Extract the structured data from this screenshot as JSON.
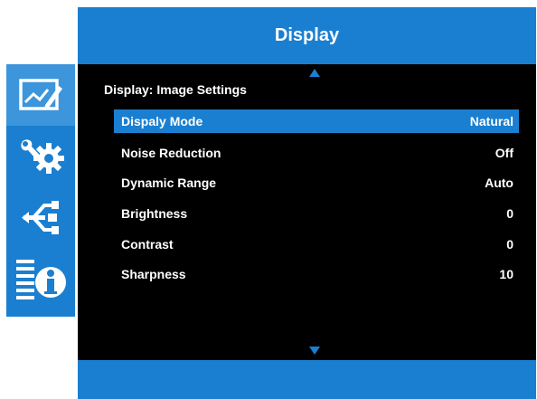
{
  "header": {
    "title": "Display"
  },
  "sidebar": {
    "items": [
      {
        "icon": "image-settings-icon",
        "active": true
      },
      {
        "icon": "tools-gear-icon",
        "active": false
      },
      {
        "icon": "usb-connection-icon",
        "active": false
      },
      {
        "icon": "information-icon",
        "active": false
      }
    ]
  },
  "panel": {
    "section_title": "Display: Image Settings",
    "rows": [
      {
        "label": "Dispaly Mode",
        "value": "Natural",
        "selected": true
      },
      {
        "label": "Noise Reduction",
        "value": "Off",
        "selected": false
      },
      {
        "label": "Dynamic Range",
        "value": "Auto",
        "selected": false
      },
      {
        "label": "Brightness",
        "value": "0",
        "selected": false
      },
      {
        "label": "Contrast",
        "value": "0",
        "selected": false
      },
      {
        "label": "Sharpness",
        "value": "10",
        "selected": false
      }
    ]
  },
  "colors": {
    "accent": "#1a7fd0",
    "accent_active": "#3d95dc",
    "panel_background": "#000000",
    "text": "#ffffff"
  }
}
